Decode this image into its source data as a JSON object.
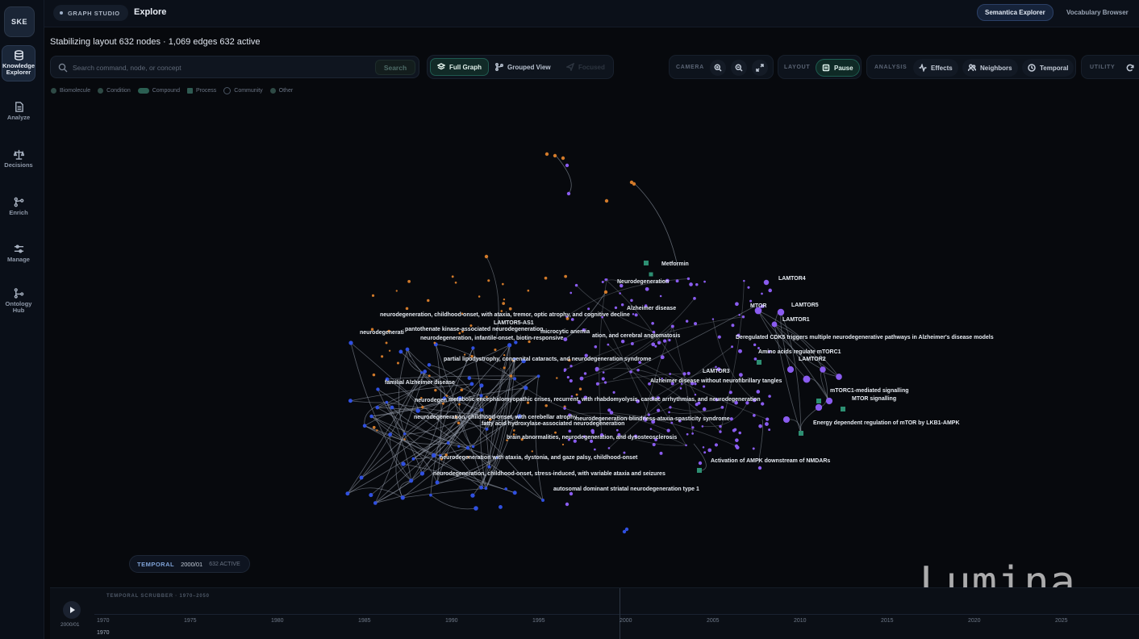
{
  "sidebar": {
    "logo": "SKE",
    "items": [
      {
        "label": "Knowledge Explorer",
        "icon": "database-icon"
      },
      {
        "label": "Analyze",
        "icon": "document-icon"
      },
      {
        "label": "Decisions",
        "icon": "scale-icon"
      },
      {
        "label": "Enrich",
        "icon": "git-merge-icon"
      },
      {
        "label": "Manage",
        "icon": "sliders-icon"
      },
      {
        "label": "Ontology Hub",
        "icon": "branch-icon"
      }
    ]
  },
  "header": {
    "studio": "GRAPH STUDIO",
    "title": "Explore",
    "semantica_explorer": "Semantica Explorer",
    "vocabulary_browser": "Vocabulary Browser"
  },
  "status": {
    "text": "Stabilizing layout  632 nodes · 1,069 edges  632 active"
  },
  "search": {
    "placeholder": "Search command, node, or concept",
    "button": "Search"
  },
  "views": {
    "full_graph": "Full Graph",
    "grouped_view": "Grouped View",
    "focused": "Focused"
  },
  "camera": {
    "label": "CAMERA"
  },
  "layout": {
    "label": "LAYOUT",
    "pause": "Pause"
  },
  "analysis": {
    "label": "ANALYSIS",
    "effects": "Effects",
    "neighbors": "Neighbors",
    "temporal": "Temporal"
  },
  "utility": {
    "label": "UTILITY"
  },
  "legend": [
    "Biomolecule",
    "Condition",
    "Compound",
    "Process",
    "Community",
    "Other"
  ],
  "colors": {
    "background": "#07090d",
    "biomolecule_node": "#8a5cf0",
    "condition_node": "#3050e0",
    "orange_node": "#d27a2a",
    "process_node": "#2d8f72",
    "edge": "#9aa3b0",
    "accent_active": "#1d5c50"
  },
  "graph_labels": [
    "Metformin",
    "Neurodegeneration",
    "LAMTOR4",
    "MTOR",
    "LAMTOR5",
    "LAMTOR1",
    "Alzheimer disease",
    "neurodegeneration, childhood-onset, with ataxia, tremor, optic atrophy, and cognitive decline",
    "LAMTOR5-AS1",
    "pantothenate kinase-associated neurodegeneration",
    "neurodegenerati",
    "microcytic anemia",
    "ation, and cerebral angiomatosis",
    "neurodegeneration, infantile-onset, biotin-responsive",
    "Deregulated CDK5 triggers multiple neurodegenerative pathways in Alzheimer's disease models",
    "Amino acids regulate mTORC1",
    "partial lipodystrophy, congenital cataracts, and neurodegeneration syndrome",
    "LAMTOR2",
    "LAMTOR3",
    "Alzheimer disease without neurofibrillary tangles",
    "familial Alzheimer disease",
    "mTORC1-mediated signalling",
    "MTOR signalling",
    "neurodegen",
    "metabolic encephalomyopathic crises, recurrent, with rhabdomyolysis, cardiac arrhythmias, and neurodegeneration",
    "neurodegeneration, childhood-onset, with cerebellar atrophy",
    "neurodegeneration-blindness-ataxia-spasticity syndrome",
    "Energy dependent regulation of mTOR by LKB1-AMPK",
    "fatty acid hydroxylase-associated neurodegeneration",
    "brain abnormalities, neurodegeneration, and dysosteosclerosis",
    "neurodegeneration with ataxia, dystonia, and gaze palsy, childhood-onset",
    "Activation of AMPK downstream of NMDARs",
    "neurodegeneration, childhood-onset, stress-induced, with variable ataxia and seizures",
    "autosomal dominant striatal neurodegeneration type 1"
  ],
  "temporal_chip": {
    "label": "TEMPORAL",
    "date": "2000/01",
    "active": "632 ACTIVE"
  },
  "scrubber": {
    "title": "TEMPORAL SCRUBBER · 1970–2050",
    "current": "2000/01",
    "start": "1970",
    "ticks": [
      "1970",
      "1975",
      "1980",
      "1985",
      "1990",
      "1995",
      "2000",
      "2005",
      "2010",
      "2015",
      "2020",
      "2025"
    ]
  },
  "watermark": "Lumina"
}
